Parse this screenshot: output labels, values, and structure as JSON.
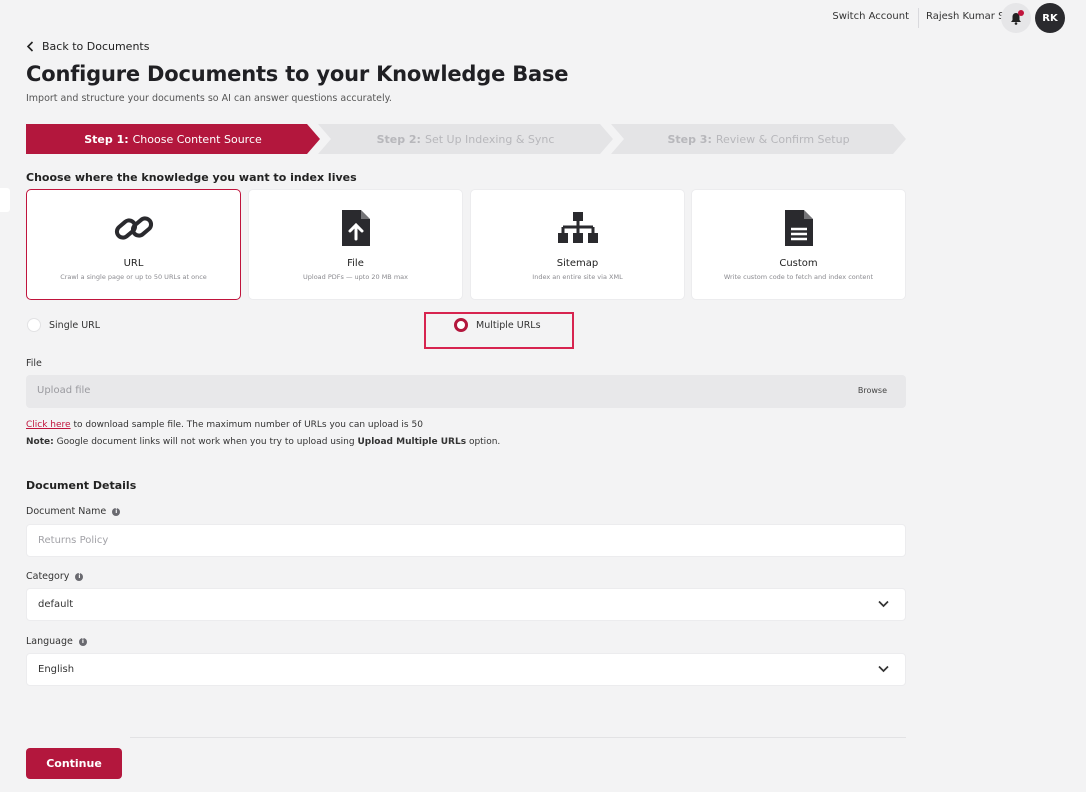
{
  "topbar": {
    "switch_account": "Switch Account",
    "user_name": "Rajesh Kumar S",
    "avatar_initials": "RK"
  },
  "header": {
    "back_label": "Back to Documents",
    "title": "Configure Documents to your Knowledge Base",
    "subtitle": "Import and structure your documents so AI can answer questions accurately."
  },
  "stepper": {
    "steps": [
      {
        "prefix": "Step 1:",
        "label": "Choose Content Source"
      },
      {
        "prefix": "Step 2:",
        "label": "Set Up Indexing & Sync"
      },
      {
        "prefix": "Step 3:",
        "label": "Review & Confirm Setup"
      }
    ]
  },
  "source": {
    "prompt": "Choose where the knowledge you want to index lives",
    "cards": [
      {
        "name": "URL",
        "desc": "Crawl a single page or up to 50 URLs at once",
        "icon": "link-icon"
      },
      {
        "name": "File",
        "desc": "Upload PDFs — upto 20 MB max",
        "icon": "file-upload-icon"
      },
      {
        "name": "Sitemap",
        "desc": "Index an entire site via XML",
        "icon": "sitemap-icon"
      },
      {
        "name": "Custom",
        "desc": "Write custom code to fetch and index content",
        "icon": "document-icon"
      }
    ],
    "radio_single": "Single URL",
    "radio_multiple": "Multiple URLs"
  },
  "upload": {
    "label": "File",
    "placeholder": "Upload file",
    "browse": "Browse",
    "help_link": "Click here",
    "help_text": " to download sample file. The maximum number of URLs you can upload is 50",
    "note_prefix": "Note:",
    "note_text": " Google document links will not work when you try to upload using ",
    "note_bold": "Upload Multiple URLs",
    "note_suffix": " option."
  },
  "details": {
    "title": "Document Details",
    "name_label": "Document Name",
    "name_placeholder": "Returns Policy",
    "category_label": "Category",
    "category_value": "default",
    "language_label": "Language",
    "language_value": "English"
  },
  "footer": {
    "continue": "Continue"
  },
  "colors": {
    "accent": "#b3173d",
    "highlight": "#d7244f"
  }
}
